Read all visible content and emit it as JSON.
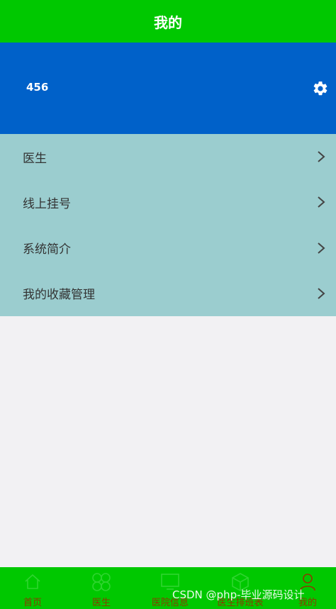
{
  "header": {
    "title": "我的"
  },
  "profile": {
    "username": "456",
    "settings_icon": "gear-icon"
  },
  "menu": {
    "items": [
      {
        "label": "医生"
      },
      {
        "label": "线上挂号"
      },
      {
        "label": "系统简介"
      },
      {
        "label": "我的收藏管理"
      }
    ]
  },
  "tabbar": {
    "tabs": [
      {
        "label": "首页",
        "icon": "home-icon"
      },
      {
        "label": "医生",
        "icon": "clover-icon"
      },
      {
        "label": "医院信息",
        "icon": "monitor-icon"
      },
      {
        "label": "医生排班表",
        "icon": "cube-icon"
      },
      {
        "label": "我的",
        "icon": "user-icon"
      }
    ]
  },
  "watermark": {
    "text": "CSDN @php-毕业源码设计"
  },
  "colors": {
    "header_bg": "#00c800",
    "profile_bg": "#0061c9",
    "menu_bg": "#9bcdcf",
    "page_bg": "#f2f1f3",
    "tab_label": "#8a3b00"
  }
}
